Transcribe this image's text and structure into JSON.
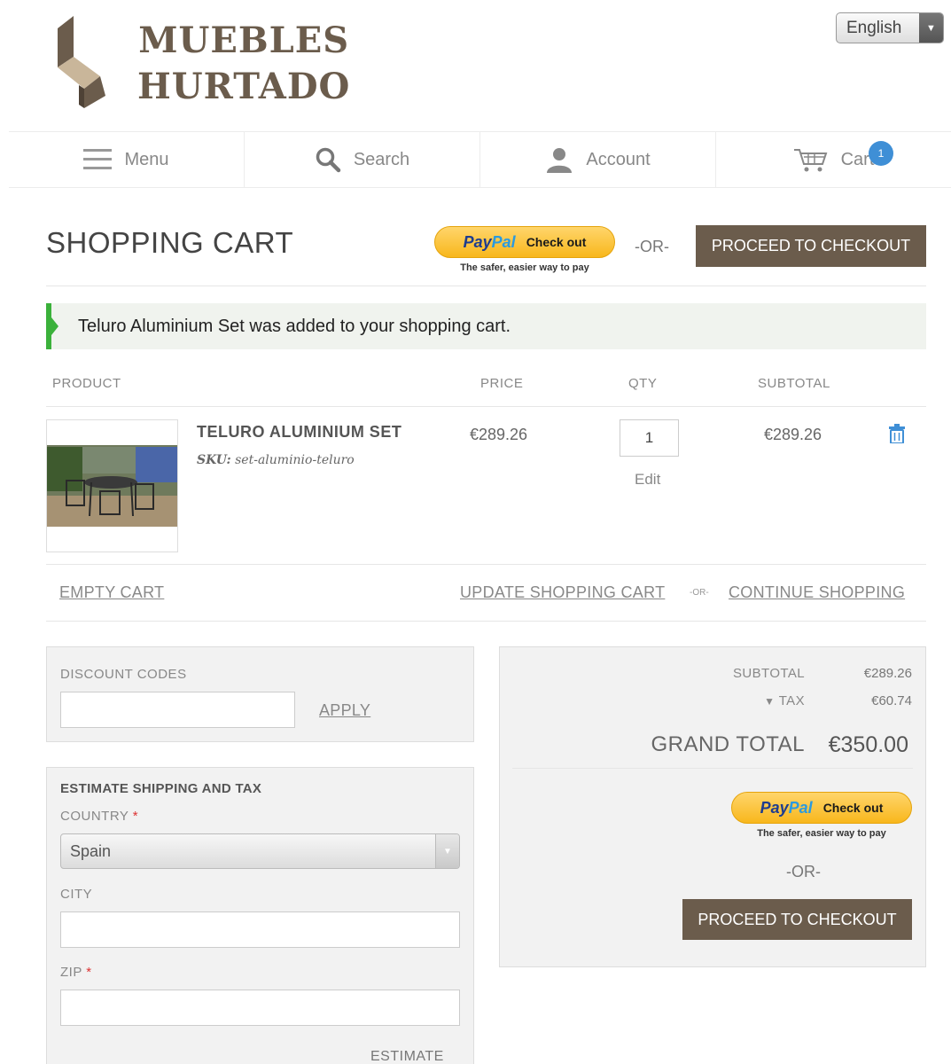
{
  "brand": {
    "line1": "MUEBLES",
    "line2": "HURTADO"
  },
  "language": {
    "selected": "English"
  },
  "nav": {
    "menu": "Menu",
    "search": "Search",
    "account": "Account",
    "cart": "Cart",
    "cart_count": "1"
  },
  "page_title": "SHOPPING CART",
  "paypal": {
    "pay": "Pay",
    "pal": "Pal",
    "check_out": "Check out",
    "tagline": "The safer, easier way to pay"
  },
  "or_label": "-OR-",
  "checkout_label": "PROCEED TO CHECKOUT",
  "message": "Teluro Aluminium Set was added to your shopping cart.",
  "table": {
    "headers": {
      "product": "PRODUCT",
      "price": "PRICE",
      "qty": "QTY",
      "subtotal": "SUBTOTAL"
    },
    "item": {
      "name": "TELURO ALUMINIUM SET",
      "sku_label": "SKU:",
      "sku": "set-aluminio-teluro",
      "price": "€289.26",
      "qty": "1",
      "edit": "Edit",
      "subtotal": "€289.26"
    }
  },
  "actions": {
    "empty_cart": "EMPTY CART",
    "update_cart": "UPDATE SHOPPING CART",
    "or_small": "-OR-",
    "continue_shopping": "CONTINUE SHOPPING"
  },
  "discount": {
    "title": "DISCOUNT CODES",
    "code": "",
    "apply": "APPLY"
  },
  "shipping": {
    "title": "ESTIMATE SHIPPING AND TAX",
    "country_label": "COUNTRY",
    "required_mark": "*",
    "country_value": "Spain",
    "city_label": "CITY",
    "city_value": "",
    "zip_label": "ZIP",
    "zip_value": "",
    "estimate": "ESTIMATE"
  },
  "totals": {
    "subtotal_label": "SUBTOTAL",
    "subtotal_value": "€289.26",
    "tax_label": "TAX",
    "tax_value": "€60.74",
    "grand_total_label": "GRAND TOTAL",
    "grand_total_value": "€350.00"
  },
  "colors": {
    "brand_brown": "#6b5c4c",
    "success_green": "#3bb13b",
    "badge_blue": "#3f8fd6",
    "paypal_yellow": "#f8b71c"
  }
}
